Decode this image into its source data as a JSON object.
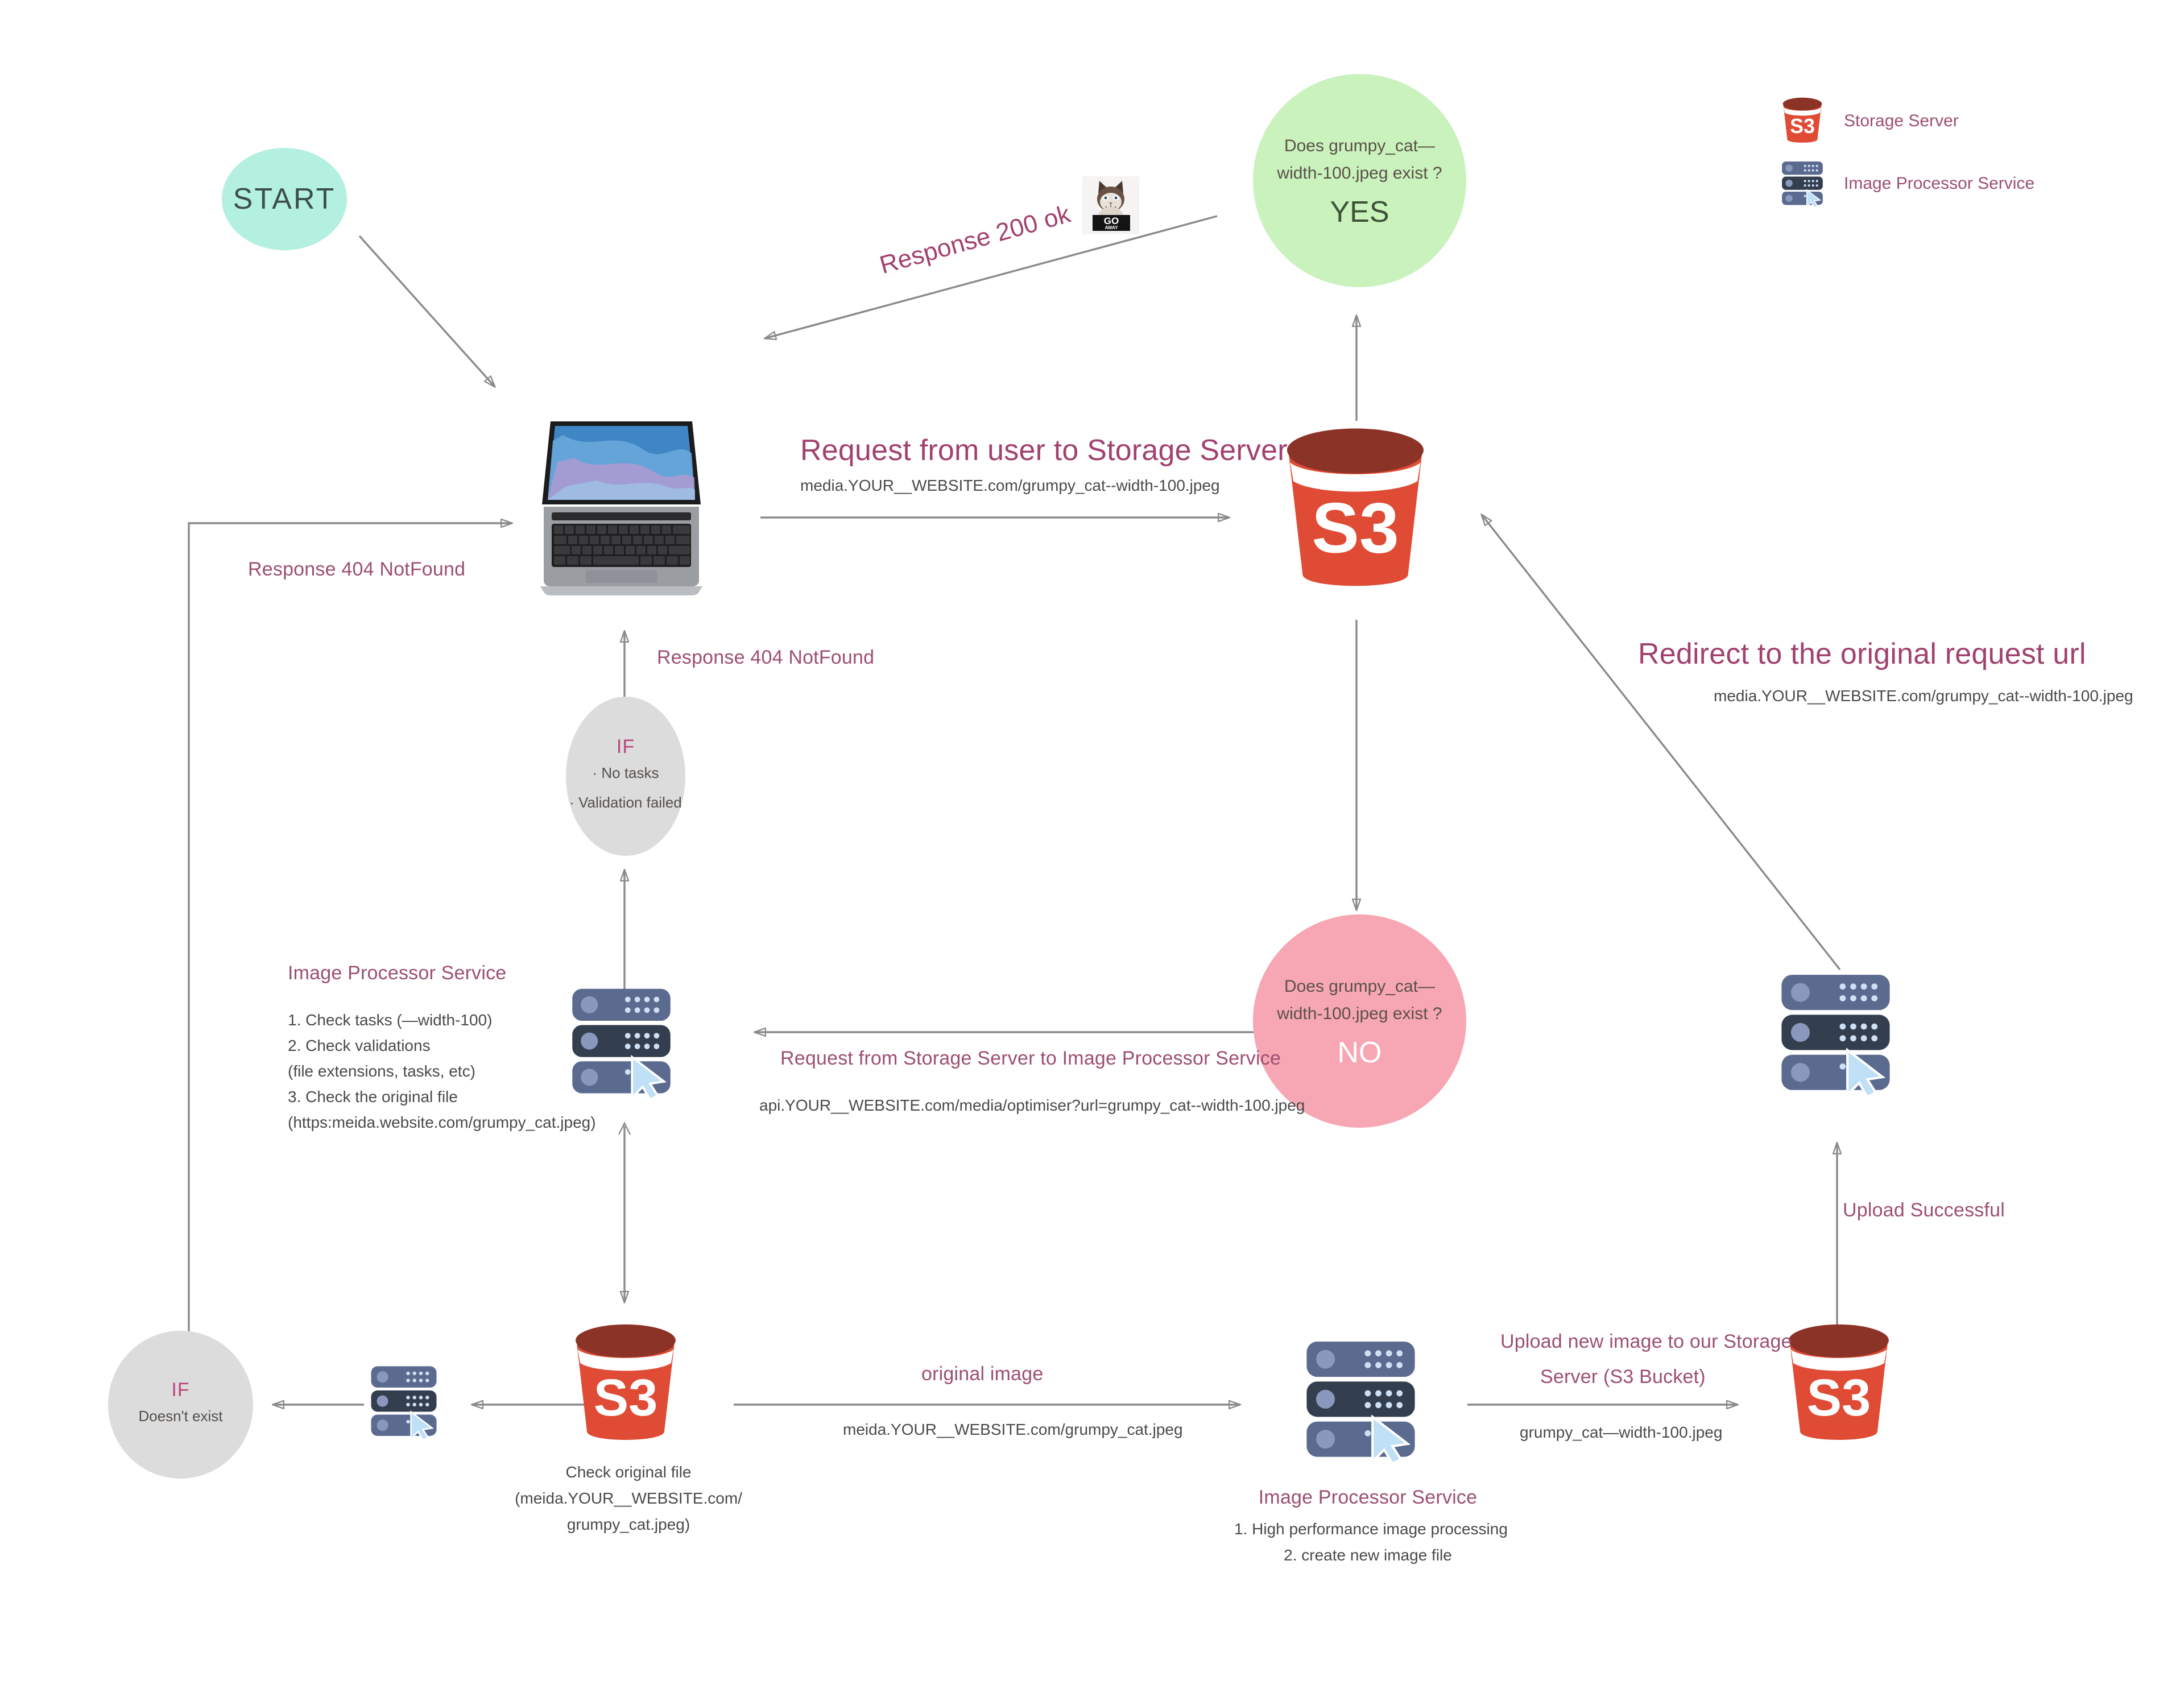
{
  "legend": {
    "items": [
      {
        "icon": "s3-bucket-icon",
        "label": "Storage Server"
      },
      {
        "icon": "server-rack-icon",
        "label": "Image Processor Service"
      }
    ]
  },
  "nodes": {
    "start": {
      "label": "START"
    },
    "decision_yes": {
      "question_line1": "Does grumpy_cat—",
      "question_line2": "width-100.jpeg  exist ?",
      "answer": "YES"
    },
    "decision_no": {
      "question_line1": "Does grumpy_cat—",
      "question_line2": "width-100.jpeg  exist ?",
      "answer": "NO"
    },
    "if_validation": {
      "title": "IF",
      "item1": "· No tasks",
      "item2": "· Validation failed"
    },
    "if_not_exist": {
      "title": "IF",
      "item1": "Doesn't exist"
    }
  },
  "edges": {
    "response_200": {
      "label": "Response 200 ok"
    },
    "request_user_to_storage": {
      "title": "Request from user to Storage Server",
      "url": "media.YOUR__WEBSITE.com/grumpy_cat--width-100.jpeg"
    },
    "redirect_original": {
      "title": "Redirect to the original request url",
      "url": "media.YOUR__WEBSITE.com/grumpy_cat--width-100.jpeg"
    },
    "response_404_left": {
      "label": "Response 404 NotFound"
    },
    "response_404_up": {
      "label": "Response 404 NotFound"
    },
    "request_storage_to_processor": {
      "title": "Request from Storage Server to Image Processor Service",
      "url": "api.YOUR__WEBSITE.com/media/optimiser?url=grumpy_cat--width-100.jpeg"
    },
    "original_image": {
      "title": "original image",
      "url": "meida.YOUR__WEBSITE.com/grumpy_cat.jpeg"
    },
    "upload_new_image": {
      "title_line1": "Upload new image to our Storage",
      "title_line2": "Server (S3 Bucket)",
      "url": "grumpy_cat—width-100.jpeg"
    },
    "upload_successful": {
      "label": "Upload Successful"
    }
  },
  "annotations": {
    "processor_left": {
      "title": "Image Processor Service",
      "lines": [
        "1. Check tasks (—width-100)",
        "2. Check validations",
        "(file extensions, tasks, etc)",
        "3. Check the original file",
        "(https:meida.website.com/grumpy_cat.jpeg)"
      ]
    },
    "processor_bottom": {
      "title": "Image Processor Service",
      "lines": [
        "1. High performance image processing",
        "2. create new image file"
      ]
    },
    "check_original_file": {
      "lines": [
        "Check original file",
        "(meida.YOUR__WEBSITE.com/",
        "grumpy_cat.jpeg)"
      ]
    }
  },
  "meme": {
    "top_text": "GO",
    "bottom_text": "AWAY"
  },
  "colors": {
    "accent_text": "#9c4f72",
    "start_fill": "#b4f0e0",
    "yes_fill": "#c9f2bd",
    "no_fill": "#f7a6b3",
    "if_fill": "#dcdcdc",
    "s3_red": "#e04b35",
    "s3_rim": "#8c3328",
    "server_blue": "#5b6a8f",
    "arrow_gray": "#8a8a8a"
  }
}
